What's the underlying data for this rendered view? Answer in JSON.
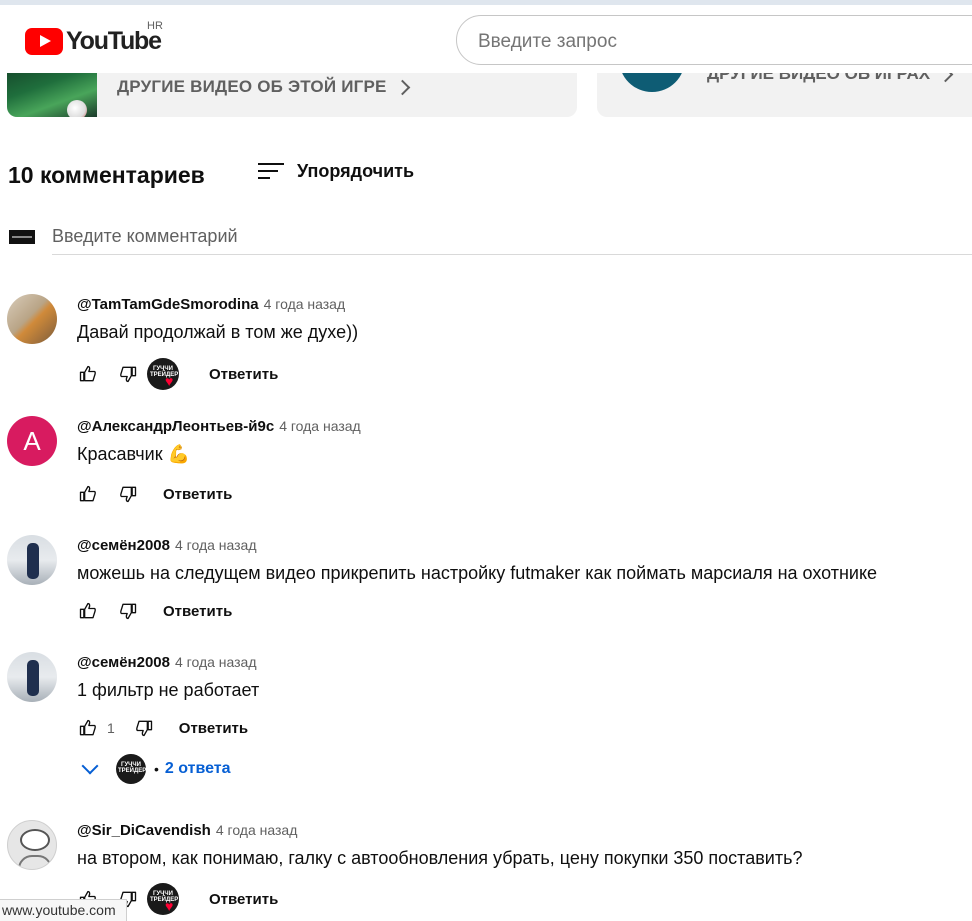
{
  "masthead": {
    "logo_text": "YouTube",
    "country_code": "HR",
    "search_placeholder": "Введите запрос"
  },
  "cards": [
    {
      "label": "ДРУГИЕ ВИДЕО ОБ ЭТОЙ ИГРЕ"
    },
    {
      "label": "ДРУГИЕ ВИДЕО ОБ ИГРАХ"
    }
  ],
  "comments_header": {
    "count_label": "10 комментариев",
    "sort_label": "Упорядочить",
    "input_placeholder": "Введите комментарий"
  },
  "comments": [
    {
      "author": "@TamTamGdeSmorodina",
      "time": "4 года назад",
      "text": "Давай продолжай в том же духе))",
      "likes": "",
      "creator_heart": true,
      "reply_label": "Ответить"
    },
    {
      "author": "@АлександрЛеонтьев-й9с",
      "avatar_letter": "А",
      "time": "4 года назад",
      "text": "Красавчик 💪",
      "likes": "",
      "creator_heart": false,
      "reply_label": "Ответить"
    },
    {
      "author": "@семён2008",
      "time": "4 года назад",
      "text": "можешь на следущем видео прикрепить настройку futmaker как поймать марсиаля на охотнике",
      "likes": "",
      "creator_heart": false,
      "reply_label": "Ответить"
    },
    {
      "author": "@семён2008",
      "time": "4 года назад",
      "text": "1 фильтр не работает",
      "likes": "1",
      "creator_heart": false,
      "reply_label": "Ответить",
      "replies_label": "2 ответа"
    },
    {
      "author": "@Sir_DiCavendish",
      "time": "4 года назад",
      "text": "на втором, как понимаю, галку с автообновления убрать, цену покупки 350 поставить?",
      "likes": "",
      "creator_heart": true,
      "reply_label": "Ответить"
    }
  ],
  "creator_badge_text": "ГУЧЧИ ТРЕЙДЕР",
  "status_bar": "www.youtube.com",
  "colors": {
    "brand_red": "#ff0000",
    "link_blue": "#065fd4",
    "avatar_pink": "#d81b60"
  }
}
